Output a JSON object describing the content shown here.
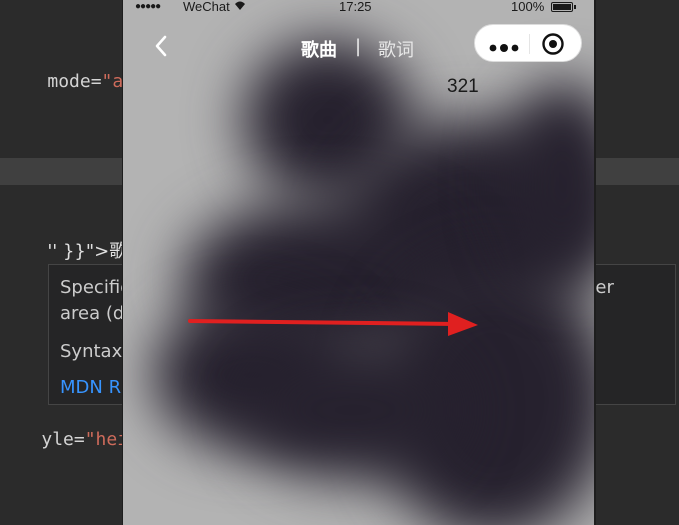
{
  "editor": {
    "line1": {
      "attr": "mode=",
      "value": "\"aspec"
    },
    "line2": {
      "text": "'' }}\">歌曲"
    },
    "line3": {
      "text": "''"
    },
    "line4": {
      "attr": "yle=",
      "value": "\"height:"
    }
  },
  "tooltip": {
    "line1": "Specifie",
    "line1_right": "der",
    "line2": "area (d",
    "line3": "Syntax:",
    "link": "MDN R"
  },
  "phone": {
    "status": {
      "signal": "●●●●●",
      "carrier": "WeChat",
      "time": "17:25",
      "battery": "100%"
    },
    "nav": {
      "tab_song": "歌曲",
      "divider": "|",
      "tab_lyric": "歌词"
    },
    "count": "321"
  },
  "colors": {
    "annotation_arrow": "#e02020",
    "string": "#ce6b5b",
    "link": "#3794ff"
  }
}
